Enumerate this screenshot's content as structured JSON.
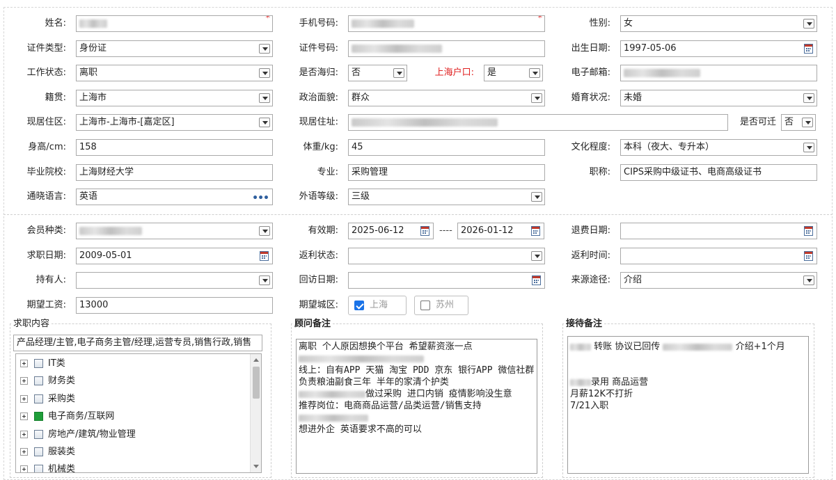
{
  "basic": {
    "name": {
      "label": "姓名:",
      "required_mark": "*"
    },
    "phone": {
      "label": "手机号码:",
      "required_mark": "*"
    },
    "gender": {
      "label": "性别:",
      "value": "女"
    },
    "id_type": {
      "label": "证件类型:",
      "value": "身份证"
    },
    "id_number": {
      "label": "证件号码:"
    },
    "birth_date": {
      "label": "出生日期:",
      "value": "1997-05-06"
    },
    "work_status": {
      "label": "工作状态:",
      "value": "离职"
    },
    "returnee": {
      "label": "是否海归:",
      "value": "否"
    },
    "shanghai_hukou": {
      "label": "上海户口:",
      "value": "是"
    },
    "email": {
      "label": "电子邮箱:"
    },
    "native_place": {
      "label": "籍贯:",
      "value": "上海市"
    },
    "political": {
      "label": "政治面貌:",
      "value": "群众"
    },
    "marital": {
      "label": "婚育状况:",
      "value": "未婚"
    },
    "residence_area": {
      "label": "现居住区:",
      "value": "上海市-上海市-[嘉定区]"
    },
    "residence_addr": {
      "label": "现居住址:"
    },
    "relocate": {
      "label": "是否可迁",
      "value": "否"
    },
    "height": {
      "label": "身高/cm:",
      "value": "158"
    },
    "weight": {
      "label": "体重/kg:",
      "value": "45"
    },
    "education": {
      "label": "文化程度:",
      "value": "本科（夜大、专升本）"
    },
    "school": {
      "label": "毕业院校:",
      "value": "上海财经大学"
    },
    "major": {
      "label": "专业:",
      "value": "采购管理"
    },
    "title": {
      "label": "职称:",
      "value": "CIPS采购中级证书、电商高级证书"
    },
    "languages": {
      "label": "通晓语言:",
      "value": "英语",
      "more": "•••"
    },
    "language_level": {
      "label": "外语等级:",
      "value": "三级"
    }
  },
  "membership": {
    "member_type": {
      "label": "会员种类:"
    },
    "validity": {
      "label": "有效期:",
      "start": "2025-06-12",
      "sep": "----",
      "end": "2026-01-12"
    },
    "refund_date": {
      "label": "退费日期:",
      "value": ""
    },
    "job_date": {
      "label": "求职日期:",
      "value": "2009-05-01"
    },
    "rebate_status": {
      "label": "返利状态:",
      "value": ""
    },
    "rebate_time": {
      "label": "返利时间:",
      "value": ""
    },
    "holder": {
      "label": "持有人:",
      "value": ""
    },
    "visit_date": {
      "label": "回访日期:",
      "value": ""
    },
    "source": {
      "label": "来源途径:",
      "value": "介绍"
    },
    "expected_salary": {
      "label": "期望工资:",
      "value": "13000"
    },
    "expected_city": {
      "label": "期望城区:",
      "options": [
        {
          "label": "上海",
          "checked": true
        },
        {
          "label": "苏州",
          "checked": false
        }
      ]
    }
  },
  "job_content": {
    "title": "求职内容",
    "summary": "产品经理/主管,电子商务主管/经理,运营专员,销售行政,销售",
    "tree": [
      {
        "label": "IT类",
        "checked": false
      },
      {
        "label": "财务类",
        "checked": false
      },
      {
        "label": "采购类",
        "checked": false
      },
      {
        "label": "电子商务/互联网",
        "checked": true
      },
      {
        "label": "房地产/建筑/物业管理",
        "checked": false
      },
      {
        "label": "服装类",
        "checked": false
      },
      {
        "label": "机械类",
        "checked": false
      }
    ]
  },
  "advisor_notes": {
    "title": "顾问备注",
    "lines": [
      "离职 个人原因想换个平台 希望薪资涨一点",
      "",
      "线上：自有APP 天猫 淘宝 PDD 京东 银行APP 微信社群",
      "负责粮油副食三年 半年的家清个护类",
      "做过采购 进口内销 疫情影响没生意",
      "推荐岗位：电商商品运营/品类运营/销售支持",
      "",
      "想进外企 英语要求不高的可以"
    ]
  },
  "reception_notes": {
    "title": "接待备注",
    "lines": [
      "转账 协议已回传",
      "介绍+1个月",
      "",
      "录用 商品运营",
      "月薪12K不打折",
      "7/21入职"
    ]
  }
}
